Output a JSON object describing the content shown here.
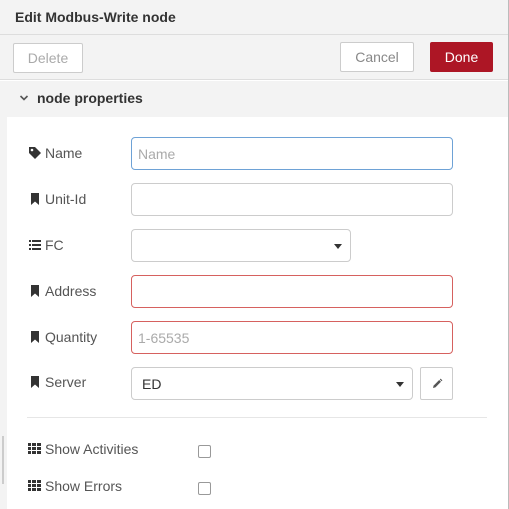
{
  "tray": {
    "title": "Edit Modbus-Write node"
  },
  "toolbar": {
    "delete_label": "Delete",
    "cancel_label": "Cancel",
    "done_label": "Done"
  },
  "section": {
    "title": "node properties",
    "icon": "chevron-down-icon"
  },
  "form": {
    "name": {
      "label": "Name",
      "icon": "tag-icon",
      "value": "",
      "placeholder": "Name"
    },
    "unit_id": {
      "label": "Unit-Id",
      "icon": "bookmark-icon",
      "value": "",
      "placeholder": ""
    },
    "fc": {
      "label": "FC",
      "icon": "list-icon",
      "selected": ""
    },
    "address": {
      "label": "Address",
      "icon": "bookmark-icon",
      "value": "",
      "placeholder": ""
    },
    "quantity": {
      "label": "Quantity",
      "icon": "bookmark-icon",
      "value": "",
      "placeholder": "1-65535"
    },
    "server": {
      "label": "Server",
      "icon": "bookmark-icon",
      "selected": "ED",
      "edit_icon": "pencil-icon"
    },
    "show_activities": {
      "label": "Show Activities",
      "icon": "grid-icon",
      "checked": false
    },
    "show_errors": {
      "label": "Show Errors",
      "icon": "grid-icon",
      "checked": false
    }
  },
  "colors": {
    "primary": "#ad1625",
    "focus_border": "#6ea2d6",
    "invalid_border": "#d6615f"
  }
}
